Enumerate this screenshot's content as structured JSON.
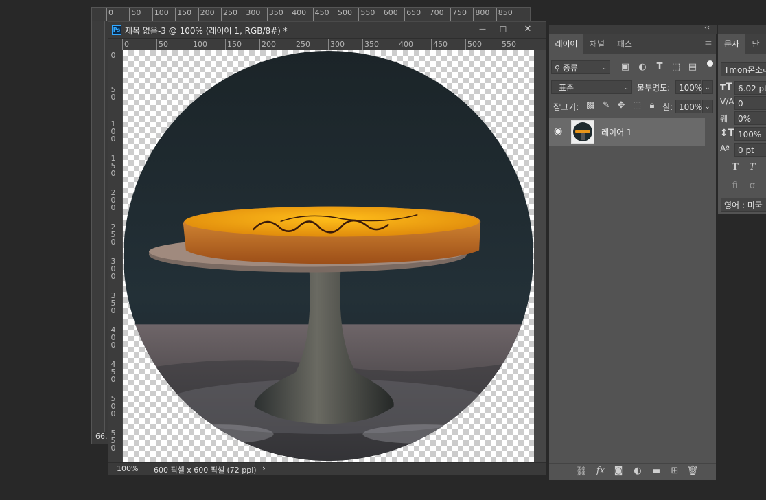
{
  "background_doc": {
    "ruler_numbers": [
      "0",
      "50",
      "100",
      "150",
      "200",
      "250",
      "300",
      "350",
      "400",
      "450",
      "500",
      "550",
      "600",
      "650",
      "700",
      "750",
      "800",
      "850"
    ],
    "zoom_text": "66."
  },
  "document": {
    "ps_badge": "Ps",
    "title": "제목 없음-3 @ 100% (레이어 1, RGB/8#) *",
    "minimize": "—",
    "maximize": "☐",
    "close": "✕",
    "ruler_numbers": [
      "0",
      "50",
      "100",
      "150",
      "200",
      "250",
      "300",
      "350",
      "400",
      "450",
      "500",
      "550"
    ],
    "vruler_numbers": [
      [
        "0"
      ],
      [
        "5",
        "0"
      ],
      [
        "1",
        "0",
        "0"
      ],
      [
        "1",
        "5",
        "0"
      ],
      [
        "2",
        "0",
        "0"
      ],
      [
        "2",
        "5",
        "0"
      ],
      [
        "3",
        "0",
        "0"
      ],
      [
        "3",
        "5",
        "0"
      ],
      [
        "4",
        "0",
        "0"
      ],
      [
        "4",
        "5",
        "0"
      ],
      [
        "5",
        "0",
        "0"
      ],
      [
        "5",
        "5",
        "0"
      ]
    ],
    "status_zoom": "100%",
    "status_info": "600 픽셀 x 600 픽셀 (72 ppi)",
    "status_arrow": "›"
  },
  "layers_panel": {
    "collapse_icon": "‹‹",
    "tabs": [
      "레이어",
      "채널",
      "패스"
    ],
    "active_tab": 0,
    "menu_icon": "≡",
    "filter_label": "종류",
    "blend_mode": "표준",
    "opacity_label": "불투명도:",
    "opacity_value": "100%",
    "lock_label": "잠그기:",
    "fill_label": "칠:",
    "fill_value": "100%",
    "layers": [
      {
        "name": "레이어 1",
        "visible": true,
        "selected": true
      }
    ]
  },
  "character_panel": {
    "tabs": [
      "문자",
      "단"
    ],
    "font_family": "Tmon몬소리",
    "font_size": "6.02 pt",
    "kerning_value": "0",
    "tracking_value": "0%",
    "vscale_value": "100%",
    "baseline_value": "0 pt",
    "language": "영어 : 미국"
  },
  "colors": {
    "app_bg": "#282828",
    "panel_bg": "#535353",
    "ruler_bg": "#3c3c3c",
    "selected_layer": "#6a6a6a"
  }
}
